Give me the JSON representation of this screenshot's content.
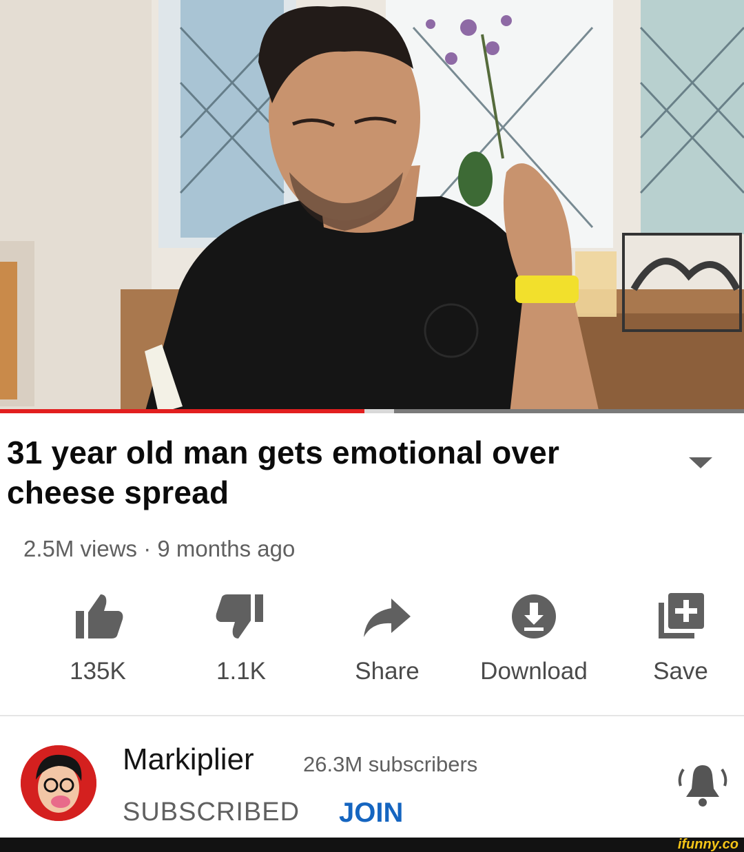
{
  "video": {
    "progress_percent": 49,
    "buffer_percent": 4
  },
  "title": {
    "text": "31 year old man gets emotional over cheese spread"
  },
  "meta": {
    "views_and_age": "2.5M views · 9 months ago"
  },
  "actions": {
    "like_count": "135K",
    "dislike_count": "1.1K",
    "share_label": "Share",
    "download_label": "Download",
    "save_label": "Save"
  },
  "channel": {
    "name": "Markiplier",
    "subscribers": "26.3M subscribers",
    "subscribed_label": "SUBSCRIBED",
    "join_label": "JOIN"
  },
  "watermark": {
    "text": "ifunny.co"
  },
  "colors": {
    "progress": "#e21f1f",
    "join": "#1565c0",
    "watermark": "#f5c518"
  }
}
